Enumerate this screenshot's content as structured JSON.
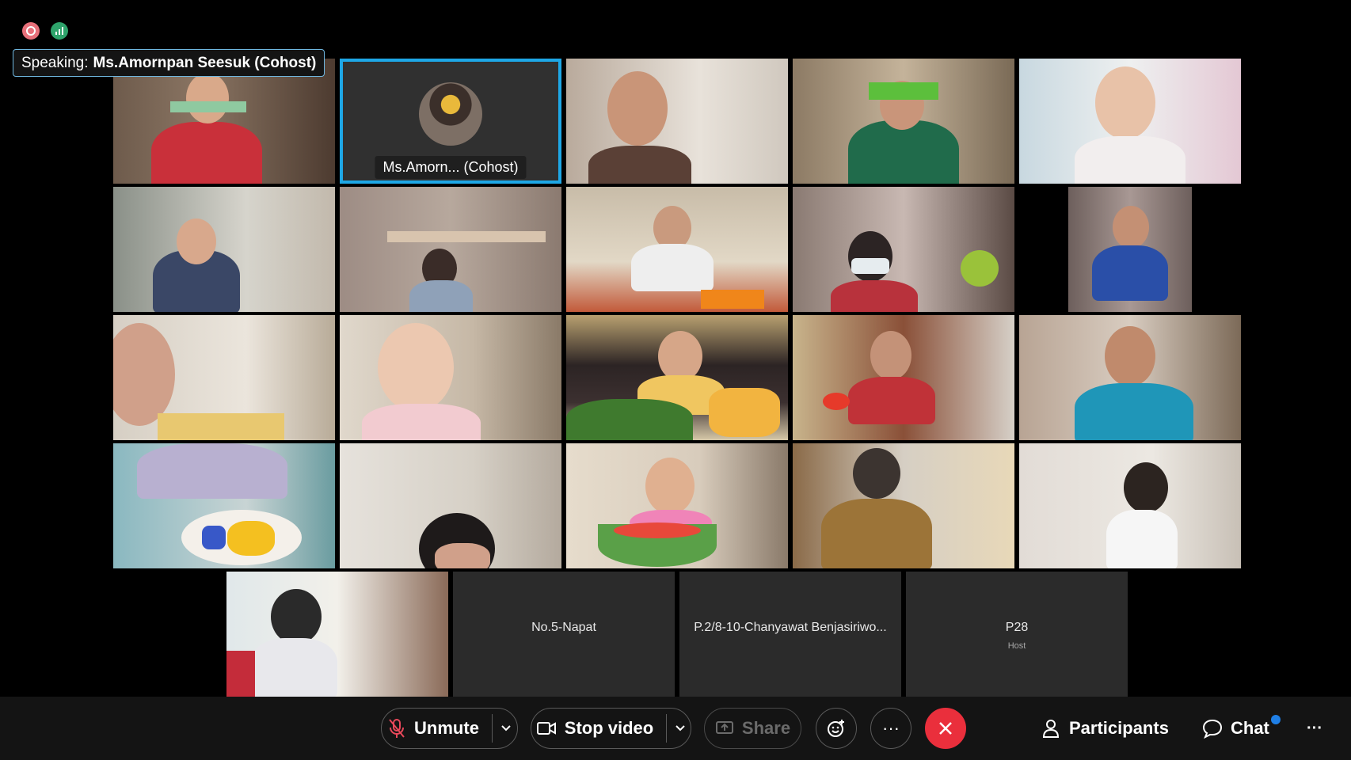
{
  "speaking": {
    "prefix": "Speaking:",
    "name": "Ms.Amornpan Seesuk (Cohost)"
  },
  "tiles": {
    "active_label": "Ms.Amorn... (Cohost)",
    "blank1": "No.5-Napat",
    "blank2": "P.2/8-10-Chanyawat Benjasiriwo...",
    "blank3": "P28",
    "blank3_role": "Host"
  },
  "toolbar": {
    "unmute": "Unmute",
    "stop_video": "Stop video",
    "share": "Share",
    "more": "···",
    "participants": "Participants",
    "chat": "Chat",
    "overflow": "···"
  },
  "colors": {
    "active_border": "#1ea7e6",
    "leave": "#ea2f3c",
    "badge": "#1f7fe6"
  }
}
